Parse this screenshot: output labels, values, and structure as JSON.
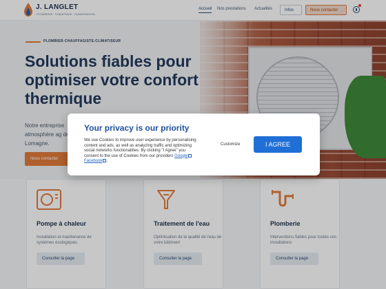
{
  "header": {
    "logo_name": "J. LANGLET",
    "logo_sub": "PLOMBERIE · CHAUFFAGE · CLIMATISATION",
    "nav": [
      "Accueil",
      "Nos prestations",
      "Actualités"
    ],
    "infos_label": "Infos",
    "contact_label": "Nous contacter",
    "colors": {
      "primary": "#223a5e",
      "accent": "#e07b3c"
    }
  },
  "hero": {
    "tagline": "PLOMBIER-CHAUFFAGISTE-CLIMATISEUR",
    "title": "Solutions fiables pour optimiser votre confort thermique",
    "text": "Notre entreprise atmosphère ag de-Lomagne.",
    "cta_label": "Nous contacter"
  },
  "cards": [
    {
      "title": "Pompe à chaleur",
      "desc": "Installation et maintenance de systèmes écologiques",
      "button": "Consulter la page",
      "icon": "heat-pump-icon"
    },
    {
      "title": "Traitement de l'eau",
      "desc": "Optimisation de la qualité de l'eau de votre bâtiment",
      "button": "Consulter la page",
      "icon": "water-filter-icon"
    },
    {
      "title": "Plomberie",
      "desc": "Interventions fiables pour toutes vos installations",
      "button": "Consulter la page",
      "icon": "pipe-icon"
    }
  ],
  "privacy": {
    "title": "Your privacy is our priority",
    "body": "We use Cookies to improve user experience by personalising content and ads, as well as analyzing traffic and optimizing social networks functionalities. By clicking \"I Agree\" you consent to the use of Cookies from our providers",
    "link_google": "Google",
    "link_facebook": "Facebook",
    "customize_label": "Customize",
    "agree_label": "I AGREE"
  }
}
